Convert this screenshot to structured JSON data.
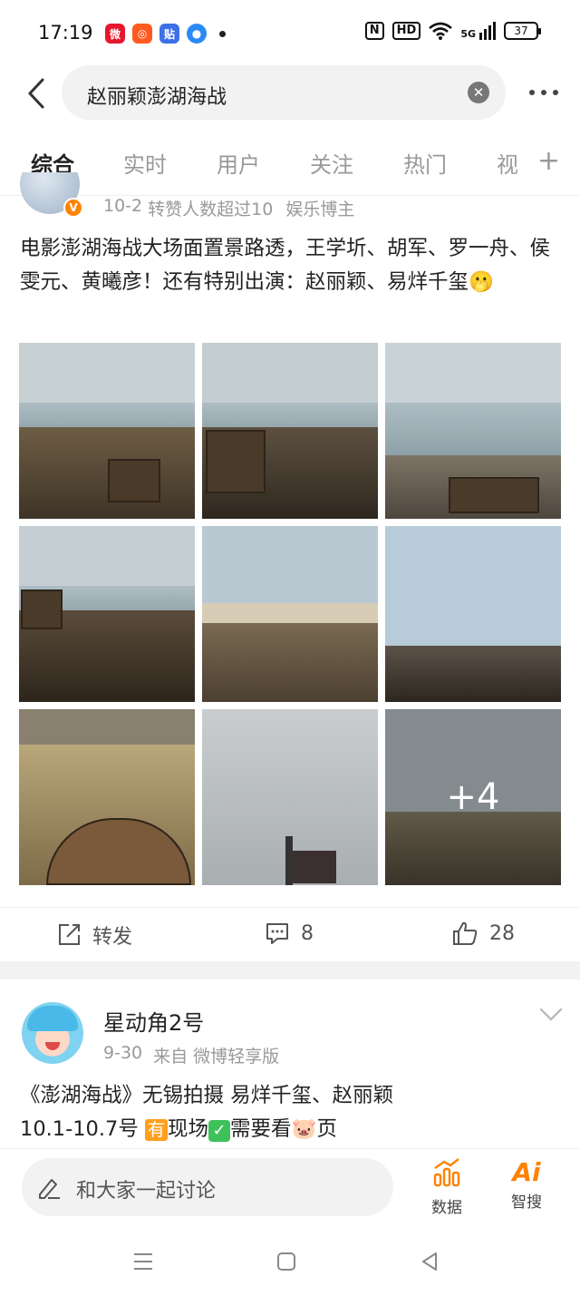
{
  "status_bar": {
    "time": "17:19",
    "apps": [
      {
        "icon": "weibo-icon",
        "color": "#e6162d"
      },
      {
        "icon": "app-orange-icon",
        "color": "#ff5a1f"
      },
      {
        "icon": "tieba-icon",
        "color": "#3d6fe6"
      },
      {
        "icon": "app-blue-icon",
        "color": "#2a8af7"
      }
    ],
    "nfc_label": "N",
    "hd_label": "HD",
    "signal_label": "5G",
    "battery": "37"
  },
  "search": {
    "query": "赵丽颖澎湖海战"
  },
  "tabs": [
    {
      "label": "综合",
      "active": true
    },
    {
      "label": "实时"
    },
    {
      "label": "用户"
    },
    {
      "label": "关注"
    },
    {
      "label": "热门"
    },
    {
      "label": "视"
    }
  ],
  "post1": {
    "date": "10-2",
    "repost_note": "转赞人数超过10",
    "tag": "娱乐博主",
    "text": "电影澎湖海战大场面置景路透，王学圻、胡军、罗一舟、侯雯元、黄曦彦！还有特别出演：赵丽颖、易烊千玺🫢",
    "more_photos": "+4",
    "actions": {
      "repost": "转发",
      "comments": "8",
      "likes": "28"
    }
  },
  "post2": {
    "author": "星动角2号",
    "date": "9-30",
    "source": "来自 微博轻享版",
    "text_line1": "《澎湖海战》无锡拍摄 易烊千玺、赵丽颖",
    "text_line2_a": "10.1-10.7号 ",
    "badge_you": "有",
    "text_line2_b": "现场",
    "text_line2_c": "需要看🐷页"
  },
  "composer": {
    "placeholder": "和大家一起讨论",
    "data_label": "数据",
    "ai_label": "智搜",
    "ai_glyph": "Ai"
  },
  "accent_color": "#ff8200"
}
